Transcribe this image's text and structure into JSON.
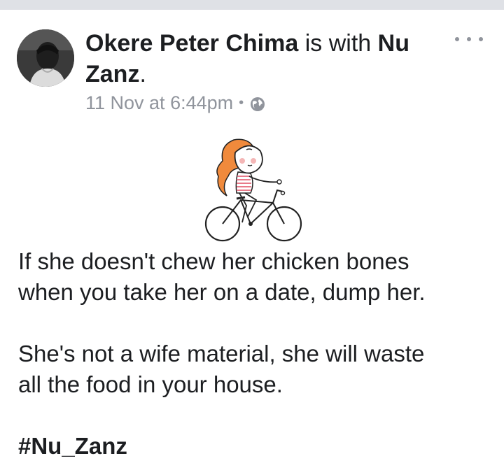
{
  "post": {
    "author": "Okere Peter Chima",
    "with_text": "is with",
    "tagged_first": "Nu",
    "tagged_second": "Zanz",
    "period": ".",
    "timestamp": "11 Nov at 6:44pm",
    "separator": "•",
    "privacy_icon": "globe-icon",
    "more_icon": "more-options-icon",
    "body": {
      "line1": "If she doesn't chew her chicken bones",
      "line2": "when you take her on a date, dump her.",
      "line3": "She's not a wife material, she will waste",
      "line4": "all the food in your house.",
      "hashtag": "#Nu_Zanz"
    }
  },
  "colors": {
    "text": "#1c1e21",
    "meta": "#90949c",
    "hair": "#f08a3c",
    "shirt_stripe": "#e87a8a"
  }
}
